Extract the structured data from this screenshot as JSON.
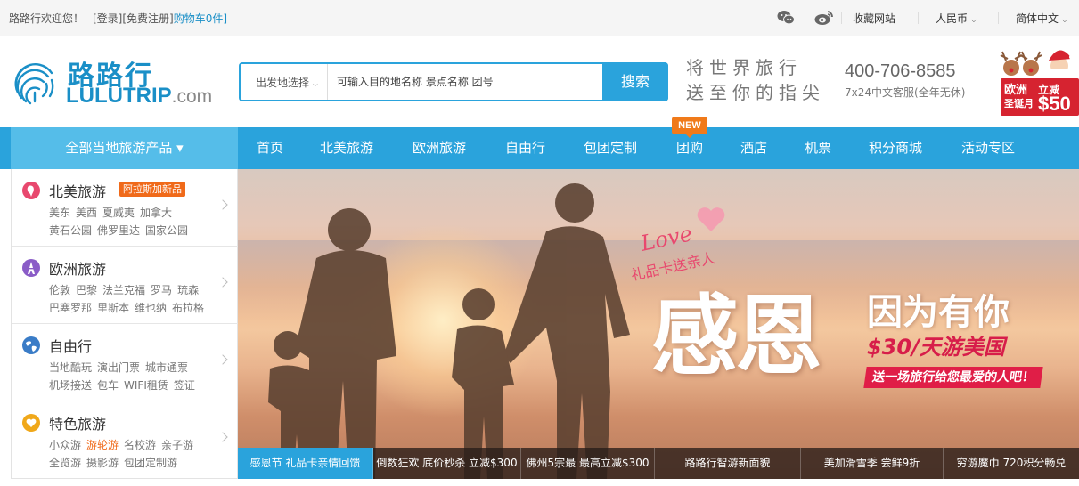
{
  "topbar": {
    "welcome": "路路行欢迎您！",
    "login": "[登录]",
    "register": "[免费注册]",
    "cart": "购物车0件]",
    "favorite": "收藏网站",
    "currency": "人民币",
    "language": "简体中文",
    "icons": [
      "wechat-icon",
      "weibo-icon"
    ]
  },
  "header": {
    "logo_cn": "路路行",
    "logo_en": "LULUTRIP",
    "logo_suffix": ".com",
    "slogan_line1": "将世界旅行",
    "slogan_line2": "送至你的指尖",
    "phone": "400-706-8585",
    "service": "7x24中文客服(全年无休)",
    "promo": {
      "line1": "欧洲",
      "line2": "圣诞月",
      "line3": "立减",
      "amount": "$50"
    }
  },
  "search": {
    "departure": "出发地选择",
    "placeholder": "可输入目的地名称 景点名称 团号",
    "button": "搜索"
  },
  "nav": {
    "all_products": "全部当地旅游产品 ▾",
    "items": [
      "首页",
      "北美旅游",
      "欧洲旅游",
      "自由行",
      "包团定制",
      "团购",
      "酒店",
      "机票",
      "积分商城",
      "活动专区"
    ],
    "new_badge": "NEW"
  },
  "categories": [
    {
      "title": "北美旅游",
      "tag": "阿拉斯加新品",
      "row1": [
        "美东",
        "美西",
        "夏威夷",
        "加拿大"
      ],
      "row2": [
        "黄石公园",
        "佛罗里达",
        "国家公园"
      ]
    },
    {
      "title": "欧洲旅游",
      "row1": [
        "伦敦",
        "巴黎",
        "法兰克福",
        "罗马",
        "琉森"
      ],
      "row2": [
        "巴塞罗那",
        "里斯本",
        "维也纳",
        "布拉格"
      ]
    },
    {
      "title": "自由行",
      "row1": [
        "当地酷玩",
        "演出门票",
        "城市通票"
      ],
      "row2": [
        "机场接送",
        "包车",
        "WIFI租赁",
        "签证"
      ]
    },
    {
      "title": "特色旅游",
      "row1": [
        "小众游",
        "游轮游",
        "名校游",
        "亲子游"
      ],
      "row2": [
        "全览游",
        "摄影游",
        "包团定制游"
      ]
    }
  ],
  "banner": {
    "love": "Love",
    "love_sub": "礼品卡送亲人",
    "headline": "感恩",
    "sub": "因为有你",
    "price": "$30/天游美国",
    "pill": "送一场旅行给您最爱的人吧！"
  },
  "ticker": [
    "感恩节 礼品卡亲情回馈",
    "倒数狂欢 底价秒杀 立减$300",
    "佛州5宗最 最高立减$300",
    "路路行智游新面貌",
    "美加滑雪季 尝鲜9折",
    "穷游魔巾 720积分畅兑"
  ],
  "colors": {
    "brand": "#2aa3dc",
    "accent": "#f06a1a",
    "promo_red": "#d62330"
  }
}
